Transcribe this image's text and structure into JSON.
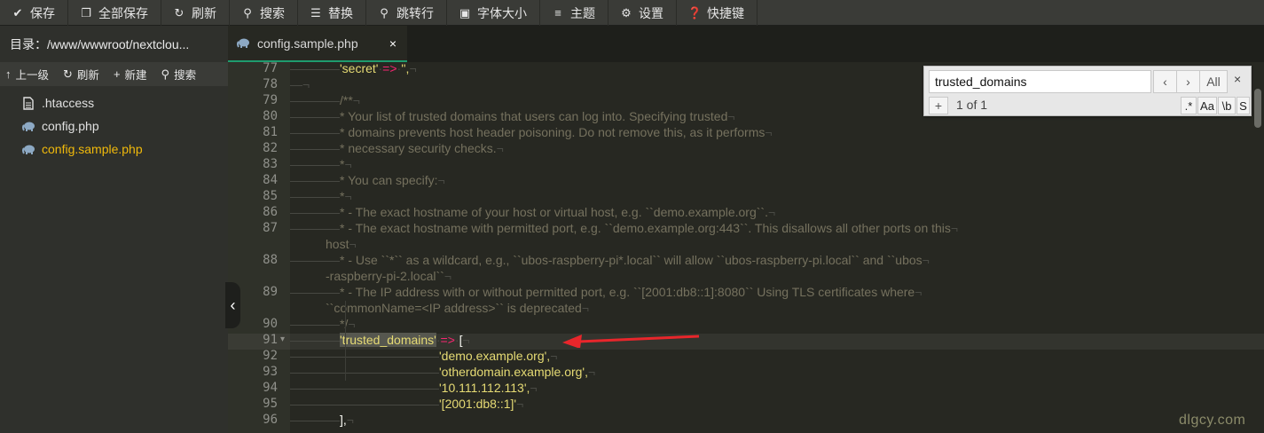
{
  "toolbar": {
    "save": "保存",
    "save_all": "全部保存",
    "refresh": "刷新",
    "search": "搜索",
    "replace": "替换",
    "goto_line": "跳转行",
    "font_size": "字体大小",
    "theme": "主题",
    "settings": "设置",
    "shortcuts": "快捷键"
  },
  "sidebar": {
    "directory": "目录：/www/wwwroot/nextclou...",
    "actions": {
      "up": "上一级",
      "refresh": "刷新",
      "new": "新建",
      "search": "搜索"
    },
    "files": [
      ".htaccess",
      "config.php",
      "config.sample.php"
    ]
  },
  "tab": {
    "title": "config.sample.php",
    "close": "×"
  },
  "editor": {
    "lines": [
      {
        "n": "77",
        "text": "'secret' => '',"
      },
      {
        "n": "78",
        "text": ""
      },
      {
        "n": "79",
        "text": "/**"
      },
      {
        "n": "80",
        "text": "* Your list of trusted domains that users can log into. Specifying trusted"
      },
      {
        "n": "81",
        "text": "* domains prevents host header poisoning. Do not remove this, as it performs"
      },
      {
        "n": "82",
        "text": "* necessary security checks."
      },
      {
        "n": "83",
        "text": "*"
      },
      {
        "n": "84",
        "text": "* You can specify:"
      },
      {
        "n": "85",
        "text": "*"
      },
      {
        "n": "86",
        "text": "* - The exact hostname of your host or virtual host, e.g. ``demo.example.org``."
      },
      {
        "n": "87",
        "text": "* - The exact hostname with permitted port, e.g. ``demo.example.org:443``. This disallows all other ports on this",
        "wrap": "host"
      },
      {
        "n": "88",
        "text": "* - Use ``*`` as a wildcard, e.g., ``ubos-raspberry-pi*.local`` will allow ``ubos-raspberry-pi.local`` and ``ubos",
        "wrap": "-raspberry-pi-2.local``"
      },
      {
        "n": "89",
        "text": "* - The IP address with or without permitted port, e.g. ``[2001:db8::1]:8080`` Using TLS certificates where",
        "wrap": "``commonName=<IP address>`` is deprecated"
      },
      {
        "n": "90",
        "text": "*/"
      },
      {
        "n": "91",
        "key": "'trusted_domains'",
        "arrow": "=>",
        "bracket": "["
      },
      {
        "n": "92",
        "text": "'demo.example.org',"
      },
      {
        "n": "93",
        "text": "'otherdomain.example.org',"
      },
      {
        "n": "94",
        "text": "'10.111.112.113',"
      },
      {
        "n": "95",
        "text": "'[2001:db8::1]'"
      },
      {
        "n": "96",
        "text": "],"
      }
    ]
  },
  "search_panel": {
    "query": "trusted_domains",
    "prev": "‹",
    "next": "›",
    "all": "All",
    "close": "×",
    "add": "+",
    "count": "1 of 1",
    "opt_regex": ".*",
    "opt_case": "Aa",
    "opt_word": "\\b",
    "opt_sel": "S"
  },
  "watermark": "dlgcy.com",
  "colors": {
    "accent_tab": "#1f9c6e",
    "active_file": "#f0b90b",
    "arrow": "#e8262b"
  }
}
